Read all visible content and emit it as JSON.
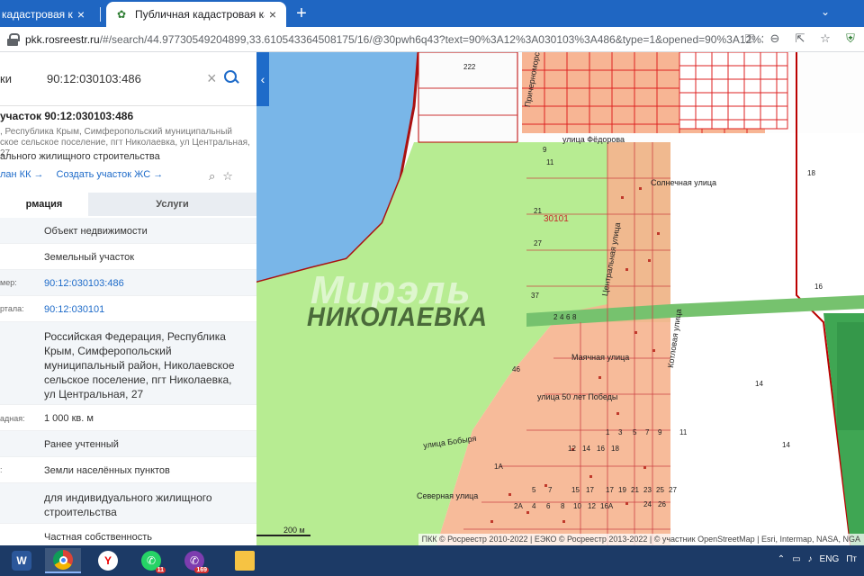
{
  "browser": {
    "tabs": [
      {
        "title": "кадастровая карта",
        "active": false
      },
      {
        "title": "Публичная кадастровая карта",
        "active": true
      }
    ],
    "new_tab": "+",
    "url_domain": "pkk.rosreestr.ru",
    "url_rest": "/#/search/44.97730549204899,33.610543364508175/16/@30pwh6q43?text=90%3A12%3A030103%3A486&type=1&opened=90%3A12%3A3...",
    "tab_search_icon": "chevron-down-icon",
    "address_icons": [
      "key-icon",
      "zoom-icon",
      "share-icon",
      "star-icon",
      "extension-icon"
    ]
  },
  "search": {
    "type_label": "ки",
    "value": "90:12:030103:486",
    "clear": "×"
  },
  "parcel": {
    "title": "участок 90:12:030103:486",
    "address_lines": [
      ", Республика Крым, Симферопольский муниципальный",
      "ское сельское поселение, пгт Николаевка, ул Центральная, 27"
    ],
    "purpose": "ального жилищного строительства",
    "link_plan": "лан КК →",
    "link_create": "Создать участок ЖС →"
  },
  "tabs": {
    "info": "рмация",
    "services": "Услуги"
  },
  "info_rows": [
    {
      "label": "",
      "value": "Объект недвижимости",
      "link": false
    },
    {
      "label": "",
      "value": "Земельный участок",
      "link": false
    },
    {
      "label": "мер:",
      "value": "90:12:030103:486",
      "link": true
    },
    {
      "label": "ртала:",
      "value": "90:12:030101",
      "link": true
    },
    {
      "label": "",
      "value": "Российская Федерация, Республика Крым, Симферопольский муниципальный район, Николаевское сельское поселение, пгт Николаевка, ул Центральная, 27",
      "link": false
    },
    {
      "label": "адная:",
      "value": "1 000 кв. м",
      "link": false
    },
    {
      "label": "",
      "value": "Ранее учтенный",
      "link": false
    },
    {
      "label": ":",
      "value": "Земли населённых пунктов",
      "link": false
    },
    {
      "label": "",
      "value": "для индивидуального жилищного строительства",
      "link": false
    },
    {
      "label": "",
      "value": "Частная собственность",
      "link": false
    }
  ],
  "map": {
    "town": "НИКОЛАЕВКА",
    "watermark": "Мирэль",
    "quarter": "30101",
    "streets": {
      "fedorova": "улица Фёдорова",
      "solnechnaya": "Солнечная улица",
      "centralnaya": "Центральная улица",
      "kotlovaya": "Котловая улица",
      "mayachnaya": "Маячная улица",
      "pobedy": "улица 50 лет Победы",
      "bobyrya": "улица Бобыря",
      "severnaya": "Северная улица",
      "prichernomorskaya": "Причерноморская ул"
    },
    "scale": "200 м",
    "attribution": "ПКК © Росреестр 2010-2022 | ЕЭКО © Росреестр 2013-2022 | © участник OpenStreetMap | Esri, Intermap, NASA, NGA",
    "parcel_numbers": [
      "222",
      "9",
      "11",
      "21",
      "27",
      "37",
      "2",
      "4",
      "6",
      "8",
      "46",
      "1",
      "3",
      "5",
      "7",
      "9",
      "11",
      "12",
      "14",
      "16",
      "18",
      "1A",
      "2A",
      "4",
      "6",
      "8",
      "10",
      "12",
      "16A",
      "17",
      "19",
      "21",
      "23",
      "25",
      "27",
      "24",
      "26",
      "5",
      "7",
      "15",
      "17"
    ],
    "side_numbers": [
      "18",
      "16",
      "14",
      "14"
    ]
  },
  "taskbar": {
    "apps": [
      {
        "name": "word-icon",
        "label": "W",
        "color": "#2b579a"
      },
      {
        "name": "chrome-icon",
        "label": "",
        "color": "#ffffff"
      },
      {
        "name": "yandex-icon",
        "label": "Y",
        "color": "#ffffff"
      },
      {
        "name": "whatsapp-icon",
        "label": "",
        "color": "#25d366",
        "badge": "11"
      },
      {
        "name": "viber-icon",
        "label": "",
        "color": "#7d3daf",
        "badge": "169"
      },
      {
        "name": "folder-icon",
        "label": "",
        "color": "#f6c343"
      }
    ],
    "language": "ENG",
    "time": "Пт"
  }
}
